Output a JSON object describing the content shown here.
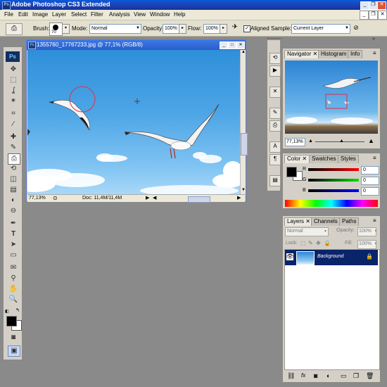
{
  "app": {
    "title": "Adobe Photoshop CS3 Extended",
    "logo": "Ps"
  },
  "menu": [
    "File",
    "Edit",
    "Image",
    "Layer",
    "Select",
    "Filter",
    "Analysis",
    "View",
    "Window",
    "Help"
  ],
  "options": {
    "brush_label": "Brush:",
    "brush_size": "70",
    "mode_label": "Mode:",
    "mode_value": "Normal",
    "opacity_label": "Opacity:",
    "opacity_value": "100%",
    "flow_label": "Flow:",
    "flow_value": "100%",
    "aligned_label": "Aligned",
    "sample_label": "Sample:",
    "sample_value": "Current Layer"
  },
  "document": {
    "title": "1355760_17767233.jpg @ 77,1% (RGB/8)",
    "zoom": "77,13%",
    "doc_info": "Doc: 11,4M/11,4M"
  },
  "navigator": {
    "tabs": [
      "Navigator",
      "Histogram",
      "Info"
    ],
    "zoom": "77,13%"
  },
  "color": {
    "tabs": [
      "Color",
      "Swatches",
      "Styles"
    ],
    "channels": [
      {
        "label": "R",
        "value": "0",
        "color": "#d01010"
      },
      {
        "label": "G",
        "value": "0",
        "color": "#10b010"
      },
      {
        "label": "B",
        "value": "0",
        "color": "#1030d0"
      }
    ]
  },
  "layers": {
    "tabs": [
      "Layers",
      "Channels",
      "Paths"
    ],
    "blend_mode": "Normal",
    "opacity_label": "Opacity:",
    "opacity_value": "100%",
    "lock_label": "Lock:",
    "fill_label": "Fill:",
    "fill_value": "100%",
    "items": [
      {
        "name": "Background"
      }
    ]
  },
  "colors": {
    "accent": "#0a246a",
    "title_blue": "#2a5dc9"
  }
}
